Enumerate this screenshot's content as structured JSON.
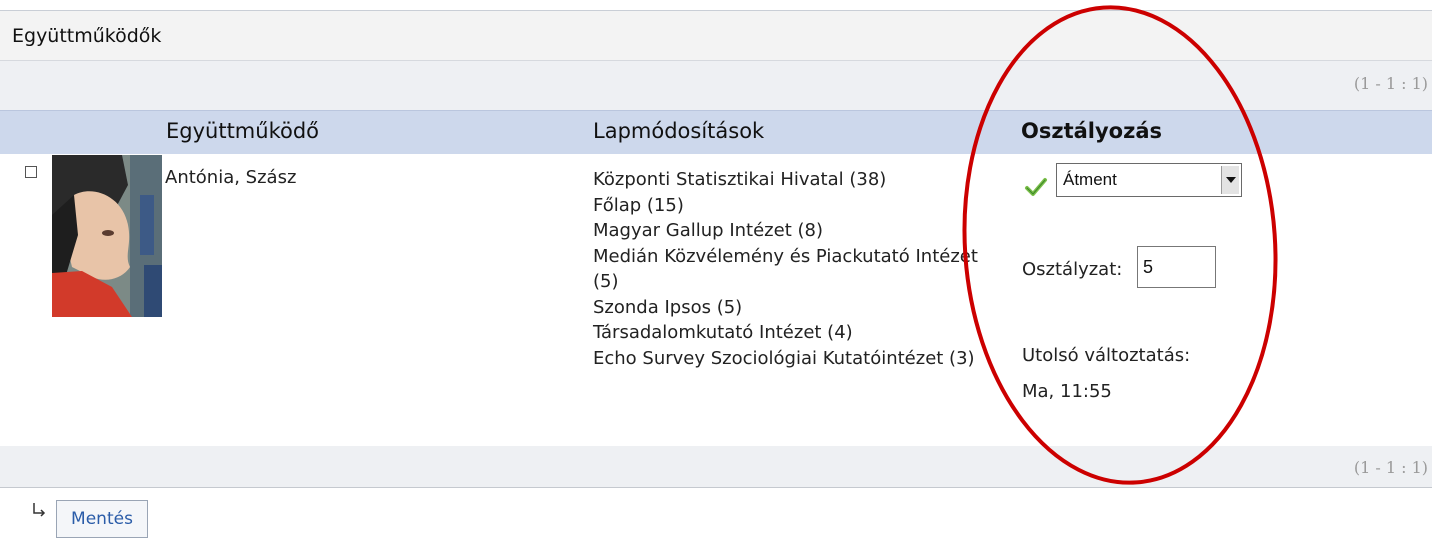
{
  "section": {
    "title": "Együttműködők"
  },
  "pager": {
    "top": "(1 - 1 : 1)",
    "bottom": "(1 - 1 : 1)"
  },
  "table": {
    "headers": {
      "collaborator": "Együttműködő",
      "changes": "Lapmódosítások",
      "grading": "Osztályozás"
    },
    "rows": [
      {
        "name": "Antónia, Szász",
        "changes": [
          "Központi Statisztikai Hivatal (38)",
          "Főlap (15)",
          "Magyar Gallup Intézet (8)",
          "Medián Közvélemény és Piackutató Intézet",
          "(5)",
          "Szonda Ipsos (5)",
          "Társadalomkutató Intézet (4)",
          "Echo Survey Szociológiai Kutatóintézet (3)"
        ],
        "status_select": "Átment",
        "grade_label": "Osztályzat:",
        "grade_value": "5",
        "last_change_label": "Utolsó változtatás:",
        "last_change_value": "Ma, 11:55"
      }
    ]
  },
  "actions": {
    "save_label": "Mentés"
  },
  "colors": {
    "header_bg": "#cdd8ec",
    "pager_bg": "#eef0f3",
    "annotation_circle": "#cc0000",
    "status_check": "#4caf50",
    "link": "#2a5ca8"
  }
}
